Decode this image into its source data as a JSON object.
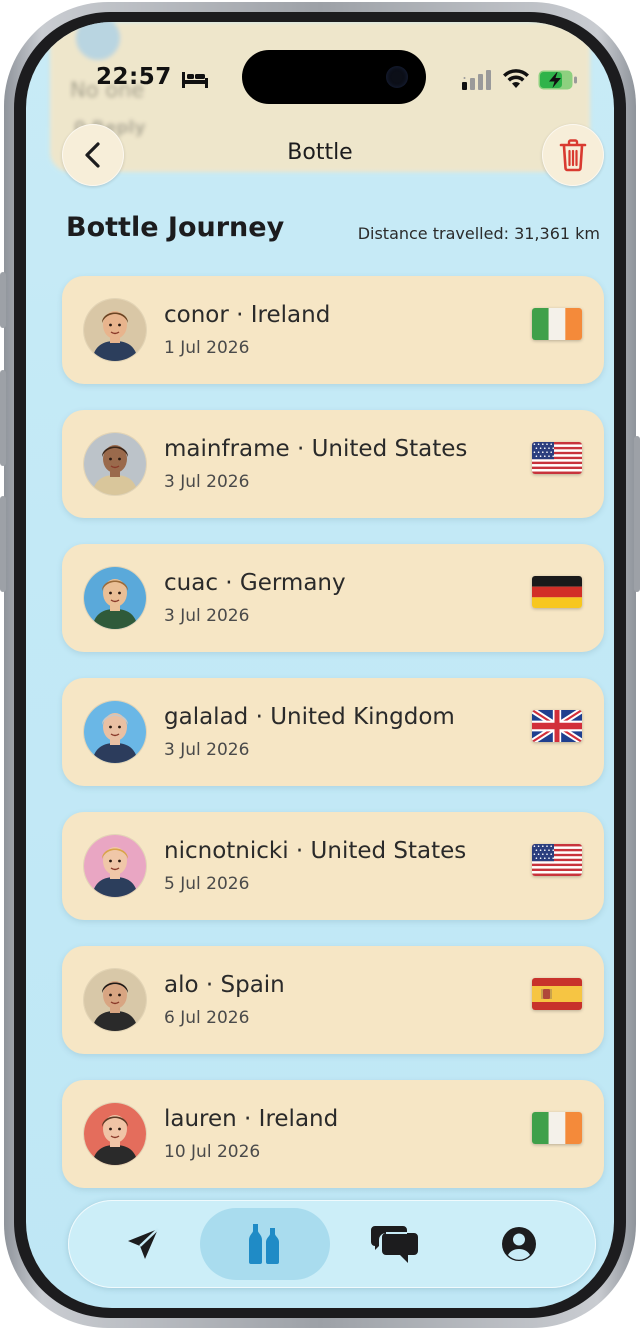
{
  "status_bar": {
    "time": "22:57"
  },
  "background": {
    "peek_line1": "No one",
    "peek_line2": "0   Reply"
  },
  "header": {
    "title": "Bottle",
    "back_icon": "chevron-left-icon",
    "delete_icon": "trash-icon"
  },
  "journey": {
    "title": "Bottle Journey",
    "distance": "Distance travelled: 31,361 km",
    "stops": [
      {
        "title": "conor · Ireland",
        "date": "1 Jul 2026",
        "flag": "ireland",
        "avatar_color": "#d9c7a6",
        "skin": "#e8b48d",
        "hair": "#6b4423",
        "shirt": "#2c3e5c"
      },
      {
        "title": "mainframe · United States",
        "date": "3 Jul 2026",
        "flag": "united-states",
        "avatar_color": "#bcc3c9",
        "skin": "#9a6a4c",
        "hair": "#3a2619",
        "shirt": "#d9c69b"
      },
      {
        "title": "cuac · Germany",
        "date": "3 Jul 2026",
        "flag": "germany",
        "avatar_color": "#5aa9da",
        "skin": "#eabf96",
        "hair": "#9b6b3a",
        "shirt": "#2f5a3a"
      },
      {
        "title": "galalad · United Kingdom",
        "date": "3 Jul 2026",
        "flag": "united-kingdom",
        "avatar_color": "#6ab7e6",
        "skin": "#e9c0a3",
        "hair": "#c8c8c8",
        "shirt": "#2c3c5c"
      },
      {
        "title": "nicnotnicki · United States",
        "date": "5 Jul 2026",
        "flag": "united-states",
        "avatar_color": "#e9a6c3",
        "skin": "#f0c7a8",
        "hair": "#d9a44a",
        "shirt": "#2c3e5c"
      },
      {
        "title": "alo · Spain",
        "date": "6 Jul 2026",
        "flag": "spain",
        "avatar_color": "#d8c8a8",
        "skin": "#d8a582",
        "hair": "#1f1a17",
        "shirt": "#2a2a2a"
      },
      {
        "title": "lauren · Ireland",
        "date": "10 Jul 2026",
        "flag": "ireland",
        "avatar_color": "#e46d5c",
        "skin": "#f0c4a6",
        "hair": "#5b3a26",
        "shirt": "#2a2a2a"
      }
    ]
  },
  "tab_bar": {
    "tabs": [
      {
        "name": "send",
        "icon": "paper-plane-icon",
        "active": false
      },
      {
        "name": "bottle",
        "icon": "bottles-icon",
        "active": true
      },
      {
        "name": "chat",
        "icon": "chat-bubbles-icon",
        "active": false
      },
      {
        "name": "profile",
        "icon": "user-circle-icon",
        "active": false
      }
    ]
  },
  "colors": {
    "background": "#c3e9f6",
    "card": "#f6e6c5",
    "active_tab": "#a9dcee",
    "bottle_icon": "#1f8bc6",
    "trash_icon": "#d93a30"
  }
}
